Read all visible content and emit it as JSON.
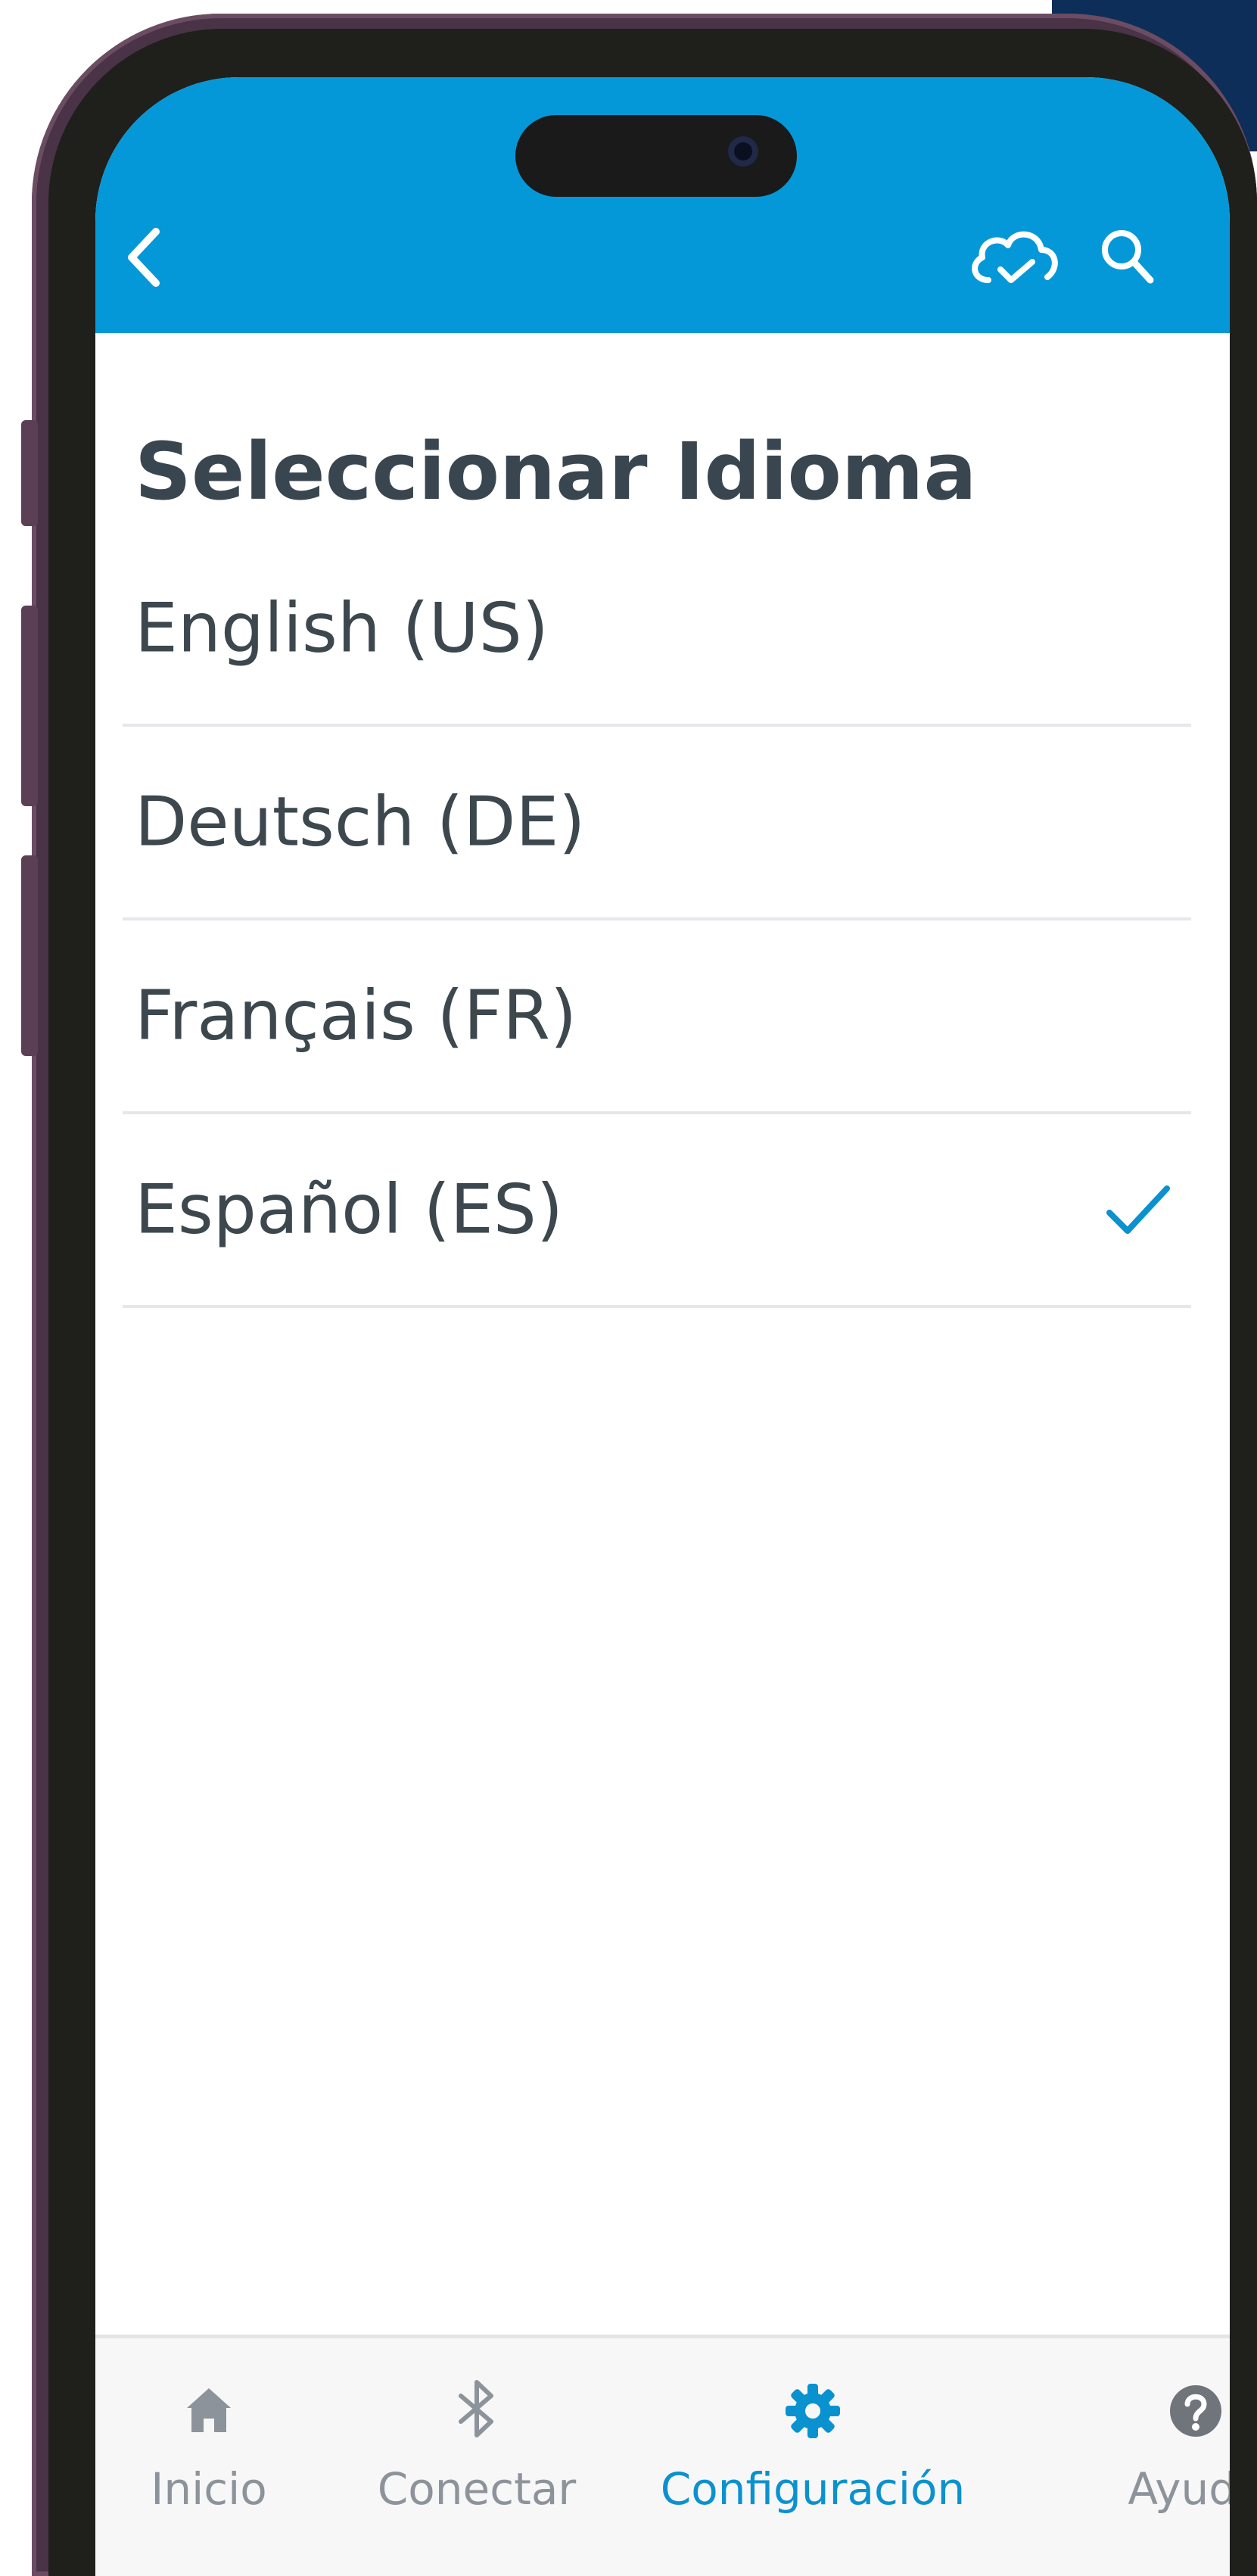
{
  "header": {
    "back_icon": "chevron-left-icon",
    "cloud_icon": "cloud-sync-icon",
    "search_icon": "search-icon",
    "background_color": "#0598d8"
  },
  "page": {
    "title": "Seleccionar Idioma"
  },
  "languages": [
    {
      "label": "English (US)",
      "selected": false
    },
    {
      "label": "Deutsch (DE)",
      "selected": false
    },
    {
      "label": "Français (FR)",
      "selected": false
    },
    {
      "label": "Español (ES)",
      "selected": true
    }
  ],
  "selection_icon": "checkmark-icon",
  "tabs": [
    {
      "label": "Inicio",
      "icon": "home-icon",
      "active": false
    },
    {
      "label": "Conectar",
      "icon": "bluetooth-icon",
      "active": false
    },
    {
      "label": "Configuración",
      "icon": "gear-icon",
      "active": true
    },
    {
      "label": "Ayuda",
      "icon": "help-icon",
      "active": false
    }
  ],
  "colors": {
    "accent": "#0a91cf",
    "title_text": "#394650",
    "item_text": "#3d474e",
    "inactive_tab": "#8d939a"
  }
}
